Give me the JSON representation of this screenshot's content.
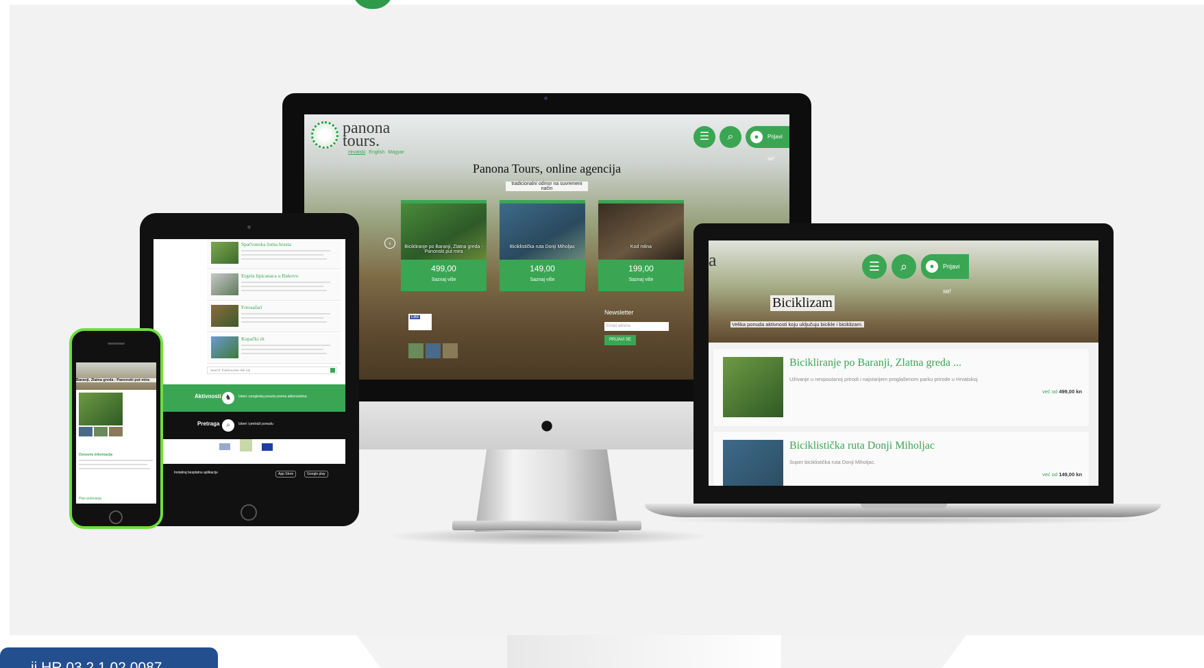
{
  "colors": {
    "brand_green": "#3aa653",
    "badge_blue": "#234f8f",
    "background": "#f2f2f2"
  },
  "imac": {
    "brand_line1": "panona",
    "brand_line2": "tours.",
    "languages": [
      "Hrvatski",
      "English",
      "Magyar"
    ],
    "login_label": "Prijavi se!",
    "hero_title": "Panona Tours, online agencija",
    "hero_subtitle": "tradicionalni odmor na suvremeni način",
    "cards": [
      {
        "caption": "Bicikliranje po Baranji, Zlatna greda - Panonski put mira",
        "price": "499,00",
        "more": "Saznaj više"
      },
      {
        "caption": "Biciklistička ruta Donji Miholjac",
        "price": "149,00",
        "more": "Saznaj više"
      },
      {
        "caption": "Kod mlina",
        "price": "199,00",
        "more": "Saznaj više"
      }
    ],
    "newsletter_title": "Newsletter",
    "newsletter_placeholder": "Email adresa",
    "newsletter_button": "PRIJAVI SE",
    "like_label": "Like"
  },
  "ipad": {
    "items": [
      {
        "title": "Spačvanska šuma hrasta"
      },
      {
        "title": "Ergela lipicanaca u Đakovu"
      },
      {
        "title": "Fotosafari"
      },
      {
        "title": "Kopački rit"
      }
    ],
    "search_placeholder": "Search: fruit/Kouzlvic fish rok",
    "band1_label": "Aktivnosti",
    "band1_text": "Izberi i pregledaj ponudu prema aktivnostima",
    "band2_label": "Pretraga",
    "band2_text": "Izberi i pretraži ponudu",
    "app_label": "Instaliraj besplatnu aplikaciju",
    "store1": "App Store",
    "store2": "Google play"
  },
  "iphone": {
    "title": "Baranji, Zlatna greda - Panonski put mira",
    "section": "Osnovne informacije",
    "more": "Plan putovanja"
  },
  "macbook": {
    "brand_fragment": "a",
    "login_label": "Prijavi se!",
    "hero_title": "Biciklizam",
    "hero_subtitle": "Velika ponuda aktivnosti koju uključuju bicikle i biciklizam.",
    "items": [
      {
        "title": "Bicikliranje po Baranji, Zlatna greda ...",
        "desc": "Uživanje u nespoutanoj prirodi i najstarijem proglašenom parku prirode u Hrvatskoj.",
        "price_prefix": "već od",
        "price": "499,00",
        "currency": "kn"
      },
      {
        "title": "Biciklistička ruta Donji Miholjac",
        "desc": "Super biciklistička ruta Donji Miholjac.",
        "price_prefix": "već od",
        "price": "149,00",
        "currency": "kn"
      }
    ]
  },
  "badge": {
    "text": "ii.HR.03.2.1.02.0087"
  }
}
